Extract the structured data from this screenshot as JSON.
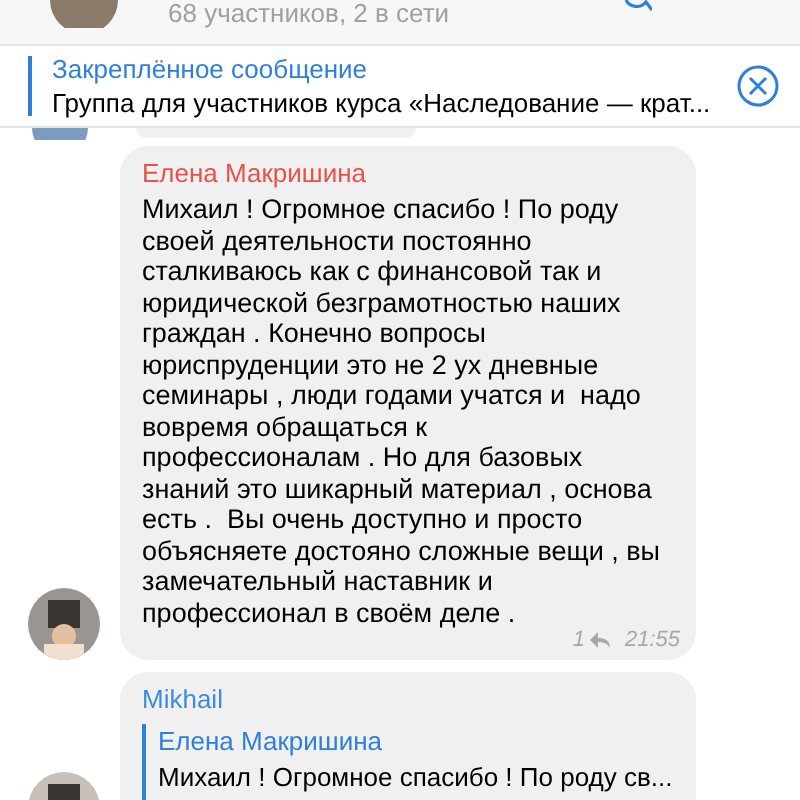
{
  "header": {
    "subtitle": "68 участников, 2 в сети"
  },
  "pinned": {
    "title": "Закреплённое сообщение",
    "text": "Группа для участников курса «Наследование — крат..."
  },
  "messages": [
    {
      "kind": "text",
      "author": "Елена Макришина",
      "color": "#e5534b",
      "text": "Михаил ! Огромное спасибо ! По роду\nсвоей деятельности постоянно\nсталкиваюсь как с финансовой так и\nюридической безграмотностью наших\nграждан . Конечно вопросы\nюриспруденции это не 2 ух дневные\nсеминары , люди годами учатся и  надо\nвовремя обращаться к\nпрофессионалам . Но для базовых\nзнаний это шикарный материал , основа\nесть .  Вы очень доступно и просто\nобъясняете достояно сложные вещи , вы\nзамечательный наставник и\nпрофессионал в своём деле .",
      "replies": "1",
      "time": "21:55"
    },
    {
      "kind": "reply",
      "author": "Mikhail",
      "color": "#3d8be0",
      "quote_author": "Елена Макришина",
      "quote_text": "Михаил ! Огромное спасибо ! По роду св..."
    }
  ]
}
